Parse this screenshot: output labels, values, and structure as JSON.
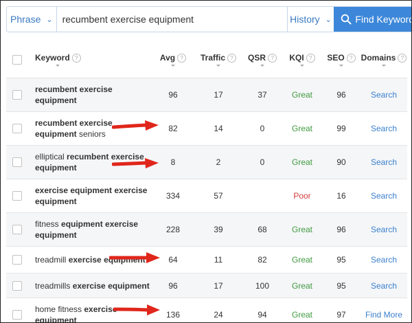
{
  "search": {
    "mode_label": "Phrase",
    "query": "recumbent exercise equipment",
    "history_label": "History",
    "find_label": "Find Keywords"
  },
  "columns": {
    "keyword": "Keyword",
    "avg": "Avg",
    "traffic": "Traffic",
    "qsr": "QSR",
    "kqi": "KQI",
    "seo": "SEO",
    "domains": "Domains"
  },
  "help_icon_glyph": "?",
  "rows": [
    {
      "kw1": "",
      "kw2": "recumbent exercise equipment",
      "kw3": "",
      "avg": "96",
      "traffic": "17",
      "qsr": "37",
      "kqi": "Great",
      "seo": "96",
      "domains": "Search"
    },
    {
      "kw1": "",
      "kw2": "recumbent exercise equipment",
      "kw3": " seniors",
      "avg": "82",
      "traffic": "14",
      "qsr": "0",
      "kqi": "Great",
      "seo": "99",
      "domains": "Search"
    },
    {
      "kw1": "elliptical ",
      "kw2": "recumbent exercise equipment",
      "kw3": "",
      "avg": "8",
      "traffic": "2",
      "qsr": "0",
      "kqi": "Great",
      "seo": "90",
      "domains": "Search"
    },
    {
      "kw1": "",
      "kw2": "exercise equipment exercise equipment",
      "kw3": "",
      "avg": "334",
      "traffic": "57",
      "qsr": "",
      "kqi": "Poor",
      "seo": "16",
      "domains": "Search"
    },
    {
      "kw1": "fitness ",
      "kw2": "equipment exercise equipment",
      "kw3": "",
      "avg": "228",
      "traffic": "39",
      "qsr": "68",
      "kqi": "Great",
      "seo": "96",
      "domains": "Search"
    },
    {
      "kw1": "treadmill ",
      "kw2": "exercise equipment",
      "kw3": "",
      "avg": "64",
      "traffic": "11",
      "qsr": "82",
      "kqi": "Great",
      "seo": "95",
      "domains": "Search"
    },
    {
      "kw1": "treadmills ",
      "kw2": "exercise equipment",
      "kw3": "",
      "avg": "96",
      "traffic": "17",
      "qsr": "100",
      "kqi": "Great",
      "seo": "95",
      "domains": "Search"
    },
    {
      "kw1": "home fitness ",
      "kw2": "exercise equipment",
      "kw3": "",
      "avg": "136",
      "traffic": "24",
      "qsr": "94",
      "kqi": "Great",
      "seo": "97",
      "domains": "Find More"
    }
  ],
  "colors": {
    "accent": "#3c87d9",
    "great": "#3f9b3f",
    "poor": "#d63b3b",
    "link": "#3a7fcc",
    "annotation_arrow": "#e0261b"
  },
  "icons": {
    "mode_dropdown": "chevron-down-icon",
    "history_dropdown": "chevron-down-icon",
    "find_button": "search-icon",
    "column_help": "question-circle-icon",
    "annotation": "red-arrow-icon"
  }
}
